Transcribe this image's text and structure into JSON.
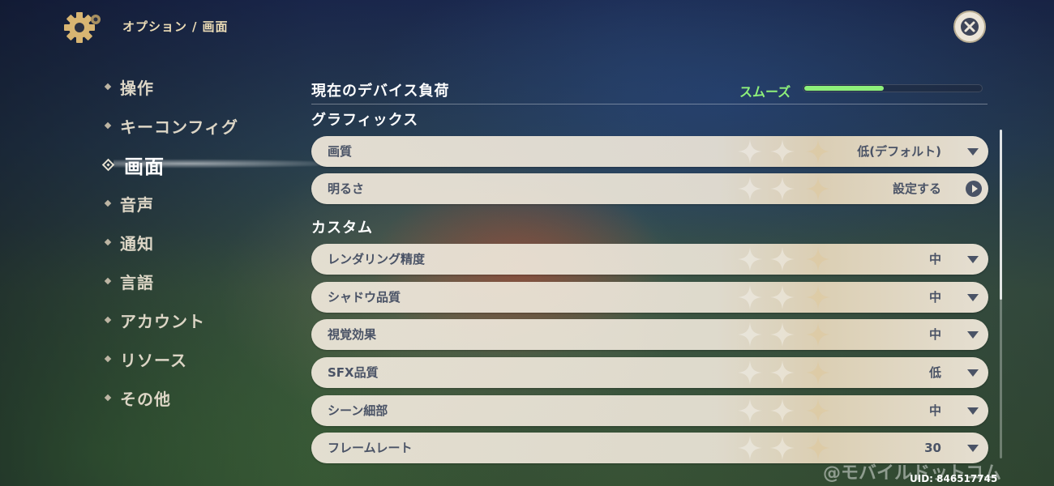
{
  "header": {
    "breadcrumb_section": "オプション",
    "breadcrumb_separator": "/",
    "breadcrumb_page": "画面"
  },
  "sidebar": {
    "items": [
      {
        "label": "操作",
        "active": false
      },
      {
        "label": "キーコンフィグ",
        "active": false
      },
      {
        "label": "画面",
        "active": true
      },
      {
        "label": "音声",
        "active": false
      },
      {
        "label": "通知",
        "active": false
      },
      {
        "label": "言語",
        "active": false
      },
      {
        "label": "アカウント",
        "active": false
      },
      {
        "label": "リソース",
        "active": false
      },
      {
        "label": "その他",
        "active": false
      }
    ]
  },
  "device_load": {
    "title": "現在のデバイス負荷",
    "status": "スムーズ",
    "level": 0.45,
    "color": "#8ef07a"
  },
  "graphics": {
    "title": "グラフィックス",
    "rows": [
      {
        "label": "画質",
        "value": "低(デフォルト)",
        "icon": "chevron-down-icon"
      },
      {
        "label": "明るさ",
        "value": "設定する",
        "icon": "arrow-circle-icon"
      }
    ]
  },
  "custom": {
    "title": "カスタム",
    "rows": [
      {
        "label": "レンダリング精度",
        "value": "中"
      },
      {
        "label": "シャドウ品質",
        "value": "中"
      },
      {
        "label": "視覚効果",
        "value": "中"
      },
      {
        "label": "SFX品質",
        "value": "低"
      },
      {
        "label": "シーン細部",
        "value": "中"
      },
      {
        "label": "フレームレート",
        "value": "30"
      }
    ]
  },
  "watermark": "@モバイルドットコム",
  "uid": "UID: 846517745",
  "colors": {
    "accent_gold": "#ecdcb6",
    "row_background": "#ece5d8",
    "row_text": "#4a5366",
    "load_green": "#8ef07a"
  }
}
